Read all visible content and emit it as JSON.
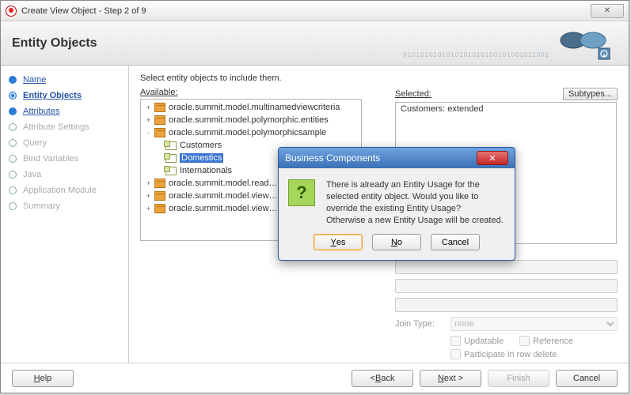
{
  "window": {
    "title": "Create View Object - Step 2 of 9"
  },
  "banner": {
    "heading": "Entity Objects"
  },
  "steps": {
    "items": [
      {
        "label": "Name",
        "state": "done"
      },
      {
        "label": "Entity Objects",
        "state": "active"
      },
      {
        "label": "Attributes",
        "state": "done"
      },
      {
        "label": "Attribute Settings",
        "state": "disabled"
      },
      {
        "label": "Query",
        "state": "disabled"
      },
      {
        "label": "Bind Variables",
        "state": "disabled"
      },
      {
        "label": "Java",
        "state": "disabled"
      },
      {
        "label": "Application Module",
        "state": "disabled"
      },
      {
        "label": "Summary",
        "state": "disabled"
      }
    ]
  },
  "content": {
    "instruction": "Select entity objects to include them.",
    "available_label": "Available:",
    "selected_label": "Selected:",
    "subtypes_label": "Subtypes...",
    "selected_items": [
      "Customers: extended"
    ],
    "tree": [
      {
        "indent": 1,
        "type": "pkg",
        "exp": "+",
        "label": "oracle.summit.model.multinamedviewcriteria"
      },
      {
        "indent": 1,
        "type": "pkg",
        "exp": "+",
        "label": "oracle.summit.model.polymorphic.entities"
      },
      {
        "indent": 1,
        "type": "pkg",
        "exp": "-",
        "label": "oracle.summit.model.polymorphicsample"
      },
      {
        "indent": 2,
        "type": "ent",
        "exp": "",
        "label": "Customers"
      },
      {
        "indent": 2,
        "type": "ent",
        "exp": "",
        "label": "Domestics",
        "selected": true
      },
      {
        "indent": 2,
        "type": "ent",
        "exp": "",
        "label": "Internationals"
      },
      {
        "indent": 1,
        "type": "pkg",
        "exp": "+",
        "label": "oracle.summit.model.read…"
      },
      {
        "indent": 1,
        "type": "pkg",
        "exp": "+",
        "label": "oracle.summit.model.view…"
      },
      {
        "indent": 1,
        "type": "pkg",
        "exp": "+",
        "label": "oracle.summit.model.view…"
      }
    ],
    "lower": {
      "join_type_label": "Join Type:",
      "join_type_value": "none",
      "updatable": "Updatable",
      "reference": "Reference",
      "participate": "Participate in row delete"
    }
  },
  "footer": {
    "help": "Help",
    "back": "< Back",
    "next": "Next >",
    "finish": "Finish",
    "cancel": "Cancel"
  },
  "dialog": {
    "title": "Business Components",
    "message": "There is already an Entity Usage for the selected entity object. Would you like to override the existing Entity Usage?\nOtherwise a new Entity Usage will be created.",
    "yes": "Yes",
    "no": "No",
    "cancel": "Cancel"
  }
}
